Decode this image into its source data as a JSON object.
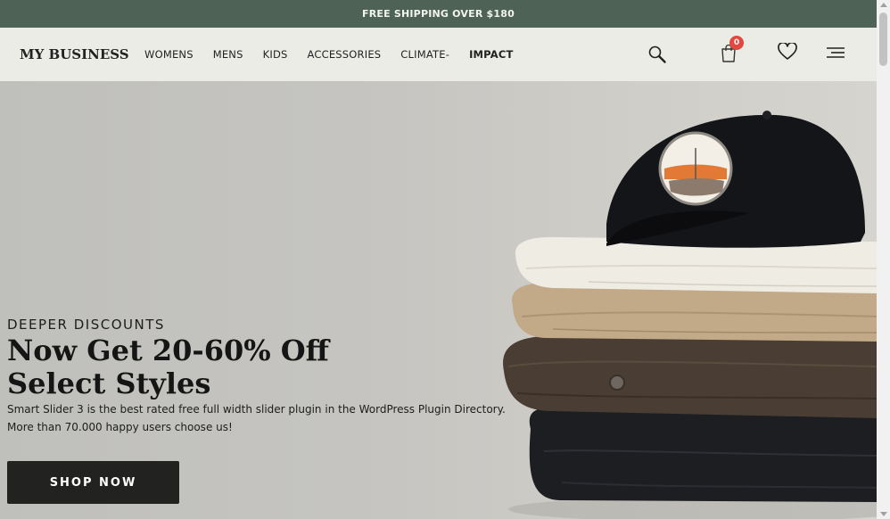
{
  "announcement": {
    "text": "FREE SHIPPING OVER $180"
  },
  "header": {
    "logo": "MY BUSINESS",
    "nav": [
      "WOMENS",
      "MENS",
      "KIDS",
      "ACCESSORIES",
      "CLIMATE-",
      "IMPACT"
    ],
    "cart_count": "0",
    "icons": [
      "search-icon",
      "cart-icon",
      "heart-icon",
      "menu-icon"
    ]
  },
  "hero": {
    "subtitle": "DEEPER DISCOUNTS",
    "title_line1": "Now Get 20-60% Off",
    "title_line2": "Select Styles",
    "desc_line1": "Smart Slider 3 is the best rated free full width slider plugin in the WordPress Plugin Directory.",
    "desc_line2": "More than 70.000 happy users choose us!",
    "cta": "SHOP NOW"
  },
  "colors": {
    "announcement_bg": "#4e6355",
    "header_bg": "#ecece7",
    "badge": "#e2483f",
    "button_bg": "#222220"
  }
}
